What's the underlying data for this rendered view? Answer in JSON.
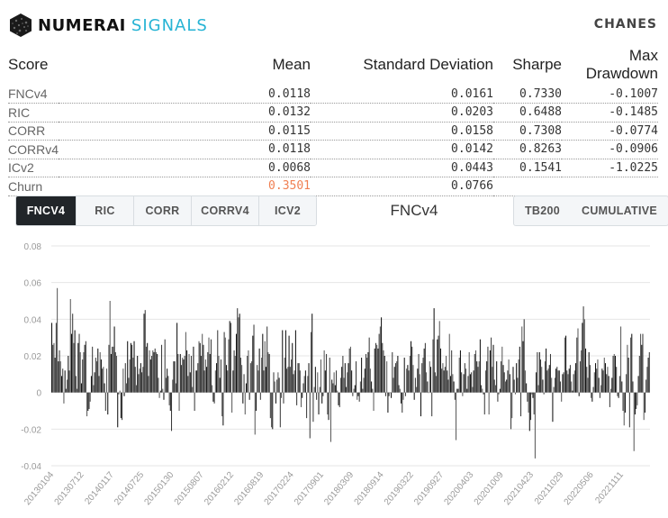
{
  "header": {
    "brand_primary": "NUMERAI",
    "brand_secondary": "SIGNALS",
    "username": "CHANES",
    "logo_icon": "numerai-hexagon-icon"
  },
  "stats_table": {
    "columns": [
      "Score",
      "Mean",
      "Standard Deviation",
      "Sharpe",
      "Max Drawdown"
    ],
    "rows": [
      {
        "score": "FNCv4",
        "mean": "0.0118",
        "std": "0.0161",
        "sharpe": "0.7330",
        "max_drawdown": "-0.1007"
      },
      {
        "score": "RIC",
        "mean": "0.0132",
        "std": "0.0203",
        "sharpe": "0.6488",
        "max_drawdown": "-0.1485"
      },
      {
        "score": "CORR",
        "mean": "0.0115",
        "std": "0.0158",
        "sharpe": "0.7308",
        "max_drawdown": "-0.0774"
      },
      {
        "score": "CORRv4",
        "mean": "0.0118",
        "std": "0.0142",
        "sharpe": "0.8263",
        "max_drawdown": "-0.0906"
      },
      {
        "score": "ICv2",
        "mean": "0.0068",
        "std": "0.0443",
        "sharpe": "0.1541",
        "max_drawdown": "-1.0225"
      },
      {
        "score": "Churn",
        "mean": "0.3501",
        "std": "0.0766",
        "sharpe": "",
        "max_drawdown": ""
      }
    ],
    "highlight_color": "#f07f52"
  },
  "score_tabs": [
    {
      "label": "FNCV4",
      "active": true
    },
    {
      "label": "RIC",
      "active": false
    },
    {
      "label": "CORR",
      "active": false
    },
    {
      "label": "CORRV4",
      "active": false
    },
    {
      "label": "ICV2",
      "active": false
    }
  ],
  "chart_options": [
    {
      "label": "TB200"
    },
    {
      "label": "CUMULATIVE"
    }
  ],
  "chart_data": {
    "type": "bar",
    "title": "FNCv4",
    "xlabel": "",
    "ylabel": "",
    "ylim": [
      -0.04,
      0.08
    ],
    "yticks": [
      0.08,
      0.06,
      0.04,
      0.02,
      0,
      -0.02,
      -0.04
    ],
    "ytick_labels": [
      "0.08",
      "0.06",
      "0.04",
      "0.02",
      "0",
      "-0.02",
      "-0.04"
    ],
    "xtick_labels": [
      "20130104",
      "20130712",
      "20140117",
      "20140725",
      "20150130",
      "20150807",
      "20160212",
      "20160819",
      "20170224",
      "20170901",
      "20180309",
      "20180914",
      "20190322",
      "20190927",
      "20200403",
      "20201009",
      "20210423",
      "20211029",
      "20220506",
      "20221111"
    ],
    "grid": true,
    "bar_color": "#222222",
    "values": [
      0.038,
      0.026,
      0.027,
      0.019,
      0.038,
      0.057,
      0.017,
      0.023,
      0.017,
      0.009,
      0.013,
      -0.006,
      0.012,
      0.002,
      0.007,
      0.02,
      0.012,
      0.051,
      0.032,
      0.043,
      0.027,
      0.034,
      0.009,
      0.002,
      0.027,
      0.032,
      0.022,
      0.005,
      0.018,
      0.022,
      0.026,
      0.028,
      -0.013,
      -0.01,
      -0.009,
      -0.005,
      0.009,
      0.025,
      0.004,
      0.011,
      0.019,
      0.017,
      0.024,
      0.009,
      0.022,
      0.018,
      0.013,
      0.014,
      0.005,
      -0.01,
      0.013,
      -0.012,
      0.026,
      0.05,
      0.021,
      0.025,
      0.025,
      0.036,
      0.022,
      0.02,
      -0.019,
      -0.001,
      0.001,
      -0.014,
      -0.015,
      0.013,
      -0.002,
      0.016,
      0.005,
      0.028,
      0.008,
      0.018,
      0.027,
      0.026,
      0.019,
      0.028,
      0.014,
      0.004,
      0.02,
      0.01,
      0.013,
      0.016,
      0.011,
      0.014,
      0.043,
      0.045,
      0.025,
      0.027,
      0.009,
      0.023,
      0.018,
      0.02,
      0.023,
      0.022,
      0.024,
      0.022,
      0.021,
      0.008,
      -0.003,
      0.001,
      0.026,
      0.002,
      -0.004,
      0.029,
      0.008,
      0.013,
      0.009,
      -0.007,
      -0.01,
      -0.021,
      0.007,
      0.017,
      0.017,
      0.005,
      0.038,
      0.021,
      -0.01,
      0.021,
      0.015,
      0.019,
      0.018,
      0.02,
      0.033,
      0.023,
      0.009,
      0.021,
      0.011,
      0.02,
      0.003,
      0.025,
      -0.01,
      0.012,
      0.012,
      0.016,
      0.028,
      0.027,
      0.02,
      0.032,
      0.026,
      0.012,
      0.018,
      0.014,
      0.022,
      0.03,
      0.021,
      0.029,
      0.004,
      -0.005,
      -0.006,
      0.012,
      0.016,
      0.034,
      0.02,
      0.008,
      0.018,
      -0.013,
      -0.018,
      0.033,
      0.03,
      0.015,
      0.012,
      0.029,
      0.039,
      0.038,
      -0.011,
      0.012,
      0.023,
      0.02,
      0.032,
      0.046,
      0.041,
      0.043,
      0.019,
      0.015,
      -0.006,
      0.01,
      -0.012,
      0.005,
      0.02,
      0.023,
      -0.004,
      0.016,
      0.017,
      0.031,
      0.037,
      -0.023,
      -0.01,
      0.015,
      0.012,
      0.024,
      -0.004,
      0.019,
      0.032,
      0.012,
      0.028,
      0.014,
      0.036,
      0.022,
      0.021,
      -0.014,
      -0.019,
      -0.02,
      0.011,
      0.006,
      -0.006,
      0.007,
      0.011,
      0.008,
      -0.019,
      -0.003,
      0.034,
      -0.006,
      0.019,
      0.034,
      0.013,
      0.014,
      0.031,
      0.014,
      0.018,
      0.027,
      0.01,
      0.012,
      0.034,
      -0.007,
      0.016,
      0.016,
      0.012,
      -0.008,
      -0.003,
      0.005,
      0.009,
      0.012,
      -0.014,
      0.009,
      0.016,
      -0.025,
      0.033,
      0.043,
      -0.016,
      0.003,
      0.014,
      -0.004,
      0.011,
      -0.012,
      0.003,
      0.018,
      -0.006,
      -0.002,
      0.023,
      0.012,
      0.021,
      -0.012,
      -0.015,
      0.019,
      -0.027,
      0.007,
      0.005,
      0.011,
      0.004,
      0.012,
      0.001,
      -0.007,
      -0.008,
      0.008,
      0.014,
      0.02,
      0.008,
      0.016,
      0.003,
      0.011,
      0.016,
      0.024,
      0.025,
      0.012,
      -0.002,
      0.002,
      0.004,
      0.017,
      -0.004,
      -0.002,
      -0.005,
      0.006,
      0.019,
      0.002,
      0.008,
      0.013,
      0.021,
      0.019,
      0.022,
      0.03,
      0.013,
      0.006,
      0.002,
      -0.01,
      0.024,
      0.027,
      0.026,
      0.024,
      0.032,
      0.036,
      0.041,
      0.027,
      0.023,
      0.02,
      -0.002,
      0.017,
      -0.011,
      -0.002,
      0.0,
      -0.003,
      0.022,
      0.008,
      0.014,
      0.016,
      0.017,
      0.02,
      0.004,
      0.002,
      -0.006,
      -0.011,
      -0.004,
      0.019,
      -0.002,
      0.013,
      0.015,
      0.012,
      0.02,
      0.028,
      0.025,
      0.015,
      -0.004,
      0.008,
      0.003,
      0.013,
      0.021,
      0.01,
      -0.013,
      0.016,
      0.019,
      0.024,
      0.027,
      0.011,
      0.006,
      0.0,
      0.017,
      0.014,
      -0.013,
      0.029,
      0.046,
      0.011,
      0.009,
      0.029,
      0.031,
      0.039,
      0.024,
      0.013,
      0.016,
      0.012,
      0.014,
      0.02,
      0.012,
      0.007,
      0.032,
      0.009,
      0.023,
      0.01,
      0.006,
      -0.004,
      -0.026,
      0.002,
      0.002,
      0.019,
      0.023,
      0.011,
      -0.002,
      0.01,
      0.016,
      0.013,
      0.002,
      0.009,
      0.022,
      0.01,
      0.011,
      0.003,
      0.012,
      0.021,
      0.023,
      0.017,
      0.014,
      0.017,
      0.029,
      0.004,
      0.002,
      -0.001,
      -0.012,
      0.012,
      0.017,
      0.025,
      -0.012,
      0.023,
      0.03,
      0.014,
      0.026,
      0.007,
      0.004,
      0.017,
      -0.005,
      -0.001,
      0.002,
      0.017,
      0.025,
      0.015,
      0.011,
      0.006,
      0.007,
      0.012,
      0.018,
      0.01,
      -0.02,
      -0.014,
      0.014,
      0.007,
      -0.001,
      0.016,
      0.008,
      0.018,
      0.025,
      -0.013,
      0.036,
      0.028,
      0.04,
      0.012,
      0.005,
      -0.005,
      -0.011,
      -0.021,
      -0.015,
      -0.001,
      -0.003,
      -0.012,
      -0.036,
      0.011,
      0.022,
      0.004,
      0.022,
      0.018,
      0.014,
      0.007,
      -0.001,
      0.017,
      0.024,
      0.012,
      0.013,
      0.015,
      0.021,
      0.008,
      -0.016,
      0.003,
      0.008,
      0.013,
      0.014,
      0.012,
      0.012,
      0.006,
      -0.005,
      0.01,
      0.011,
      0.03,
      0.031,
      0.012,
      0.01,
      0.013,
      0.015,
      0.006,
      0.001,
      0.01,
      0.012,
      0.016,
      0.03,
      0.035,
      -0.002,
      0.017,
      0.023,
      0.038,
      0.047,
      0.04,
      0.024,
      0.014,
      0.008,
      0.022,
      0.015,
      -0.003,
      -0.005,
      0.003,
      0.011,
      0.016,
      0.013,
      0.018,
      0.008,
      -0.003,
      0.004,
      0.013,
      0.012,
      0.019,
      0.016,
      0.01,
      0.014,
      0.009,
      -0.008,
      0.002,
      0.008,
      0.02,
      0.021,
      0.02,
      0.014,
      -0.002,
      -0.003,
      0.009,
      0.036,
      0.006,
      -0.01,
      -0.018,
      -0.011,
      0.01,
      0.026,
      0.019,
      -0.019,
      0.03,
      0.032,
      0.006,
      -0.032,
      -0.012,
      -0.009,
      -0.007,
      0.009,
      0.02,
      0.032,
      0.026,
      0.032,
      -0.015,
      -0.011,
      0.007,
      0.014,
      0.019,
      0.022
    ]
  }
}
